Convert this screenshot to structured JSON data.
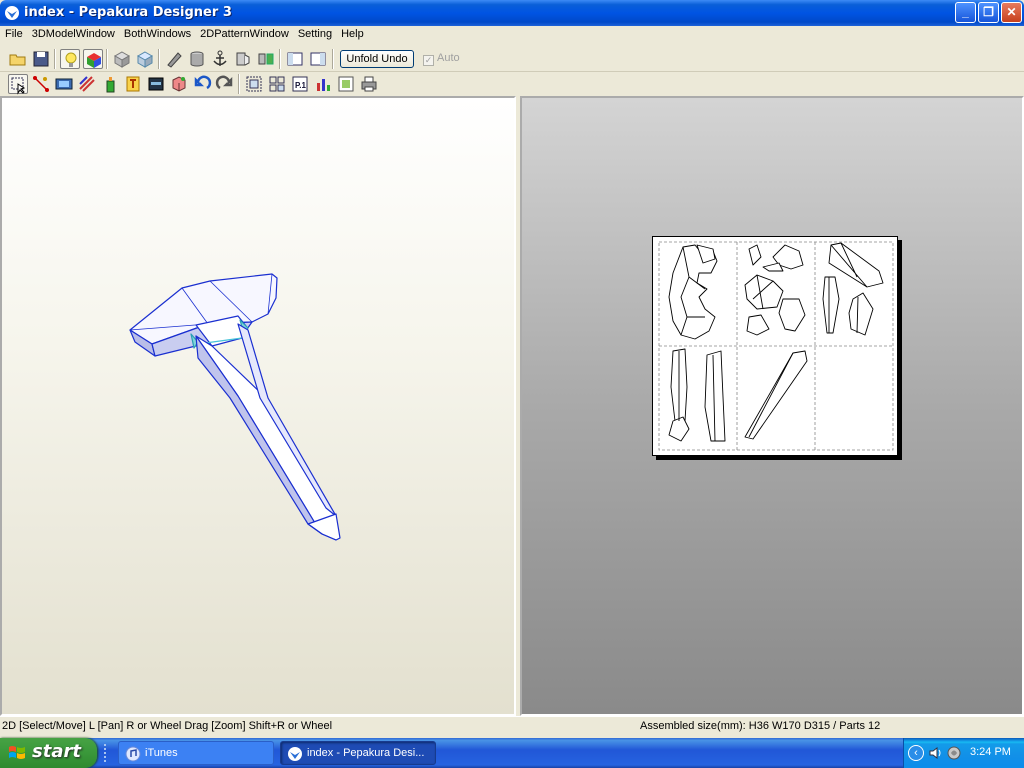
{
  "window": {
    "title": "index - Pepakura Designer 3",
    "minimize_icon": "minimize-icon",
    "maximize_icon": "restore-icon",
    "close_icon": "close-icon"
  },
  "menu": [
    "File",
    "3DModelWindow",
    "BothWindows",
    "2DPatternWindow",
    "Setting",
    "Help"
  ],
  "toolbar": {
    "unfold_undo": "Unfold Undo",
    "auto_label": "Auto",
    "auto_checked": true
  },
  "toolbar2_page_label": "P.1",
  "status": {
    "left": "2D [Select/Move] L [Pan] R or Wheel Drag [Zoom] Shift+R or Wheel",
    "right": "Assembled size(mm): H36 W170 D315 / Parts 12"
  },
  "taskbar": {
    "start": "start",
    "tasks": [
      {
        "label": "iTunes"
      },
      {
        "label": "index - Pepakura Desi..."
      }
    ],
    "clock": "3:24 PM"
  }
}
